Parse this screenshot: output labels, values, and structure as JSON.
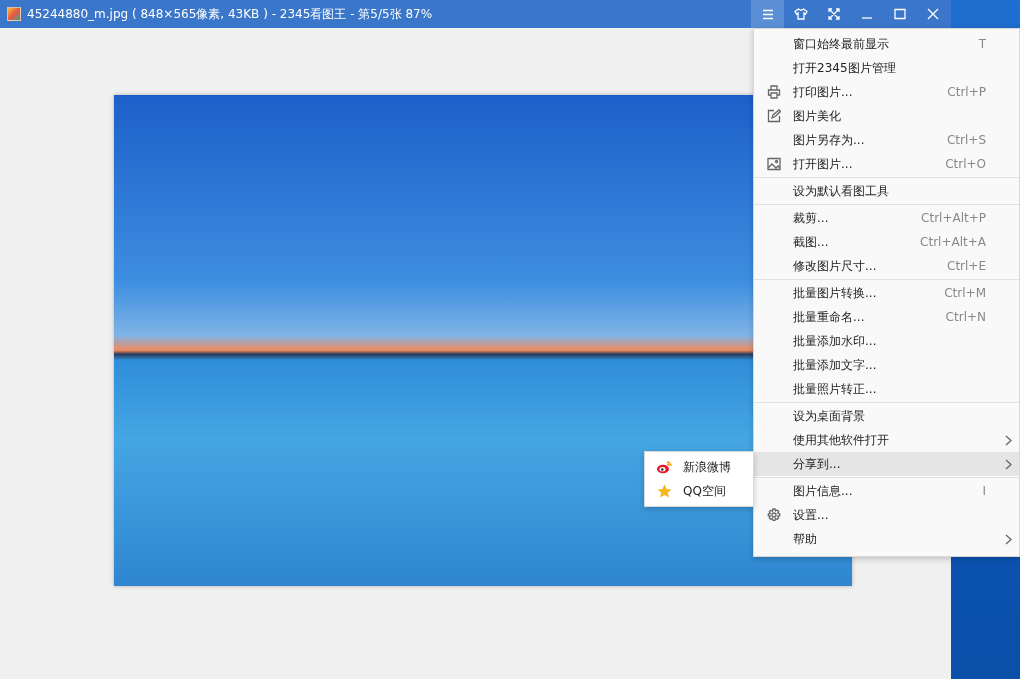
{
  "window": {
    "title": "45244880_m.jpg ( 848×565像素, 43KB ) - 2345看图王 - 第5/5张 87%"
  },
  "title_buttons": [
    {
      "kind": "menu",
      "selected": true
    },
    {
      "kind": "skin",
      "selected": false
    },
    {
      "kind": "fullscreen",
      "selected": false
    },
    {
      "kind": "minimize",
      "selected": false
    },
    {
      "kind": "maximize",
      "selected": false
    },
    {
      "kind": "close",
      "selected": false
    }
  ],
  "menu": {
    "groups": [
      [
        {
          "label": "窗口始终最前显示",
          "shortcut": "T",
          "selected": false
        },
        {
          "label": "打开2345图片管理",
          "selected": false
        },
        {
          "label": "打印图片...",
          "shortcut": "Ctrl+P",
          "kind": "print",
          "selected": false
        },
        {
          "label": "图片美化",
          "kind": "edit",
          "selected": false
        },
        {
          "label": "图片另存为...",
          "shortcut": "Ctrl+S",
          "selected": false
        },
        {
          "label": "打开图片...",
          "shortcut": "Ctrl+O",
          "kind": "image",
          "selected": false
        }
      ],
      [
        {
          "label": "设为默认看图工具",
          "selected": false
        }
      ],
      [
        {
          "label": "裁剪...",
          "shortcut": "Ctrl+Alt+P",
          "selected": false
        },
        {
          "label": "截图...",
          "shortcut": "Ctrl+Alt+A",
          "selected": false
        },
        {
          "label": "修改图片尺寸...",
          "shortcut": "Ctrl+E",
          "selected": false
        }
      ],
      [
        {
          "label": "批量图片转换...",
          "shortcut": "Ctrl+M",
          "selected": false
        },
        {
          "label": "批量重命名...",
          "shortcut": "Ctrl+N",
          "selected": false
        },
        {
          "label": "批量添加水印...",
          "selected": false
        },
        {
          "label": "批量添加文字...",
          "selected": false
        },
        {
          "label": "批量照片转正...",
          "selected": false
        }
      ],
      [
        {
          "label": "设为桌面背景",
          "selected": false
        },
        {
          "label": "使用其他软件打开",
          "submenu": true,
          "selected": false
        },
        {
          "label": "分享到...",
          "submenu": true,
          "selected": true
        }
      ],
      [
        {
          "label": "图片信息...",
          "shortcut": "I",
          "selected": false
        },
        {
          "label": "设置...",
          "kind": "gear",
          "selected": false
        },
        {
          "label": "帮助",
          "submenu": true,
          "selected": false
        }
      ]
    ]
  },
  "share_menu": [
    {
      "label": "新浪微博",
      "kind": "weibo"
    },
    {
      "label": "QQ空间",
      "kind": "star"
    }
  ]
}
